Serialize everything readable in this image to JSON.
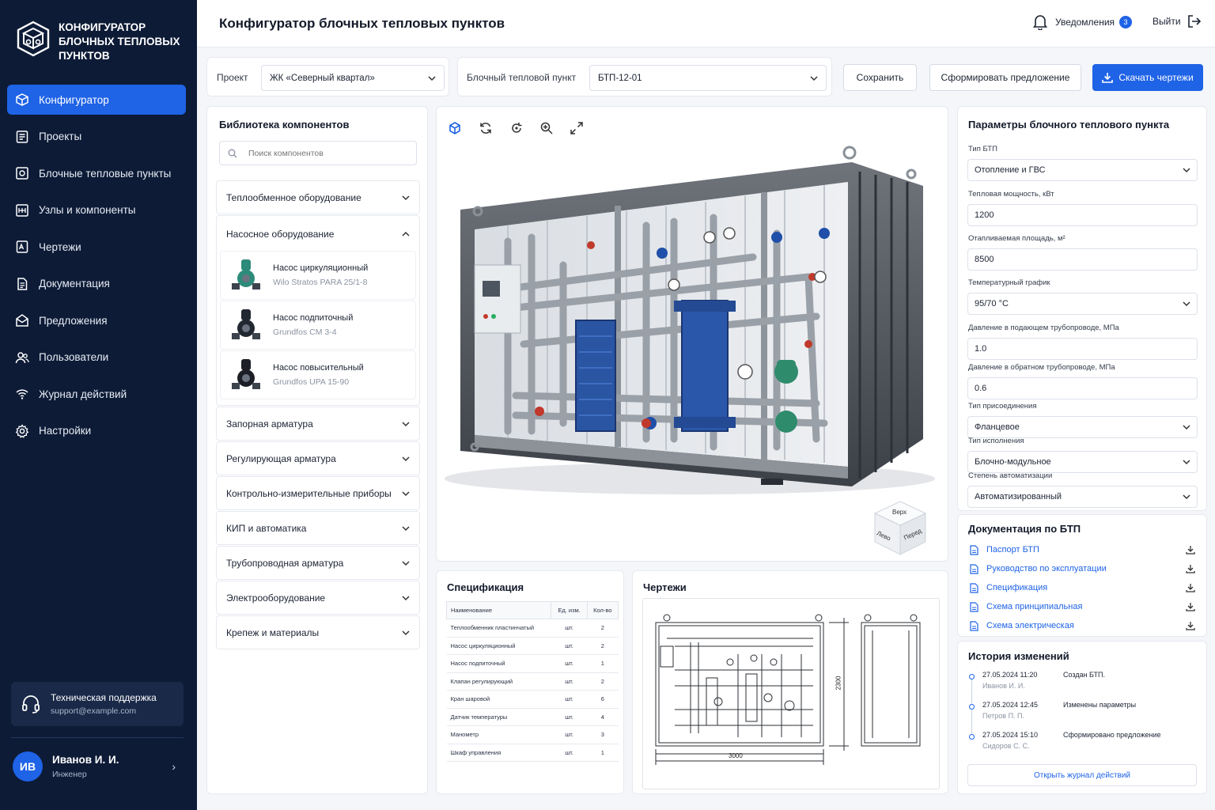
{
  "app": {
    "name": "Конфигуратор блочных тепловых пунктов"
  },
  "sidebar": {
    "items": [
      {
        "label": "Конфигуратор",
        "icon": "box-icon",
        "active": true
      },
      {
        "label": "Проекты",
        "icon": "list-icon"
      },
      {
        "label": "Блочные тепловые пункты",
        "icon": "module-icon"
      },
      {
        "label": "Узлы и компоненты",
        "icon": "components-icon"
      },
      {
        "label": "Чертежи",
        "icon": "drawing-icon"
      },
      {
        "label": "Документация",
        "icon": "document-icon"
      },
      {
        "label": "Предложения",
        "icon": "envelope-icon"
      },
      {
        "label": "Пользователи",
        "icon": "users-icon"
      },
      {
        "label": "Журнал действий",
        "icon": "activity-icon"
      },
      {
        "label": "Настройки",
        "icon": "gear-icon"
      }
    ],
    "support": {
      "title": "Техническая поддержка",
      "email": "support@example.com"
    },
    "user": {
      "initials": "ИВ",
      "name": "Иванов И. И.",
      "role": "Инженер"
    }
  },
  "header": {
    "title": "Конфигуратор блочных тепловых пунктов",
    "notifications_label": "Уведомления",
    "notifications_count": "3",
    "logout_label": "Выйти"
  },
  "toolbar": {
    "project_label": "Проект",
    "project_value": "ЖК «Северный квартал»",
    "btp_label": "Блочный тепловой пункт",
    "btp_value": "БТП-12-01",
    "save_label": "Сохранить",
    "offer_label": "Сформировать предложение",
    "download_label": "Скачать чертежи"
  },
  "library": {
    "title": "Библиотека компонентов",
    "search_placeholder": "Поиск компонентов",
    "groups_top": [
      "Теплообменное оборудование"
    ],
    "expanded_group": "Насосное оборудование",
    "components": [
      {
        "name": "Насос циркуляционный",
        "model": "Wilo Stratos PARA 25/1-8",
        "color": "#2e8b7a"
      },
      {
        "name": "Насос подпиточный",
        "model": "Grundfos CM 3-4",
        "color": "#222831"
      },
      {
        "name": "Насос повысительный",
        "model": "Grundfos UPA 15-90",
        "color": "#1c1f26"
      }
    ],
    "groups_bottom": [
      "Запорная арматура",
      "Регулирующая арматура",
      "Контрольно-измерительные приборы",
      "КИП и автоматика",
      "Трубопроводная арматура",
      "Электрооборудование",
      "Крепеж и материалы"
    ]
  },
  "viewer": {
    "cube_labels": {
      "top": "Верх",
      "left": "Лево",
      "front": "Перед"
    }
  },
  "spec": {
    "title": "Спецификация",
    "columns": [
      "Наименование",
      "Ед. изм.",
      "Кол-во"
    ],
    "rows": [
      [
        "Теплообменник пластинчатый",
        "шт.",
        "2"
      ],
      [
        "Насос циркуляционный",
        "шт.",
        "2"
      ],
      [
        "Насос подпиточный",
        "шт.",
        "1"
      ],
      [
        "Клапан регулирующий",
        "шт.",
        "2"
      ],
      [
        "Кран шаровой",
        "шт.",
        "6"
      ],
      [
        "Датчик температуры",
        "шт.",
        "4"
      ],
      [
        "Манометр",
        "шт.",
        "3"
      ],
      [
        "Шкаф управления",
        "шт.",
        "1"
      ]
    ]
  },
  "drawings": {
    "title": "Чертежи",
    "width_dim": "3000",
    "height_dim": "2300"
  },
  "params": {
    "title": "Параметры блочного теплового пункта",
    "fields": [
      {
        "label": "Тип БТП",
        "value": "Отопление и ГВС",
        "kind": "select"
      },
      {
        "label": "Тепловая мощность, кВт",
        "value": "1200",
        "kind": "input"
      },
      {
        "label": "Отапливаемая площадь, м²",
        "value": "8500",
        "kind": "input"
      },
      {
        "label": "Температурный график",
        "value": "95/70 °С",
        "kind": "select"
      },
      {
        "label": "Давление в подающем трубопроводе, МПа",
        "value": "1.0",
        "kind": "input"
      },
      {
        "label": "Давление в обратном трубопроводе, МПа",
        "value": "0.6",
        "kind": "input"
      },
      {
        "label": "Тип присоединения",
        "value": "Фланцевое",
        "kind": "select"
      },
      {
        "label": "Тип исполнения",
        "value": "Блочно-модульное",
        "kind": "select"
      },
      {
        "label": "Степень автоматизации",
        "value": "Автоматизированный",
        "kind": "select"
      }
    ]
  },
  "docs": {
    "title": "Документация по БТП",
    "items": [
      "Паспорт БТП",
      "Руководство по эксплуатации",
      "Спецификация",
      "Схема принципиальная",
      "Схема электрическая"
    ]
  },
  "history": {
    "title": "История изменений",
    "items": [
      {
        "date": "27.05.2024 11:20",
        "user": "Иванов И. И.",
        "event": "Создан БТП."
      },
      {
        "date": "27.05.2024 12:45",
        "user": "Петров П. П.",
        "event": "Изменены параметры"
      },
      {
        "date": "27.05.2024 15:10",
        "user": "Сидоров С. С.",
        "event": "Сформировано предложение"
      }
    ],
    "open_log_label": "Открыть журнал действий"
  },
  "colors": {
    "accent": "#1f63e6",
    "sidebar": "#0d1b36"
  }
}
